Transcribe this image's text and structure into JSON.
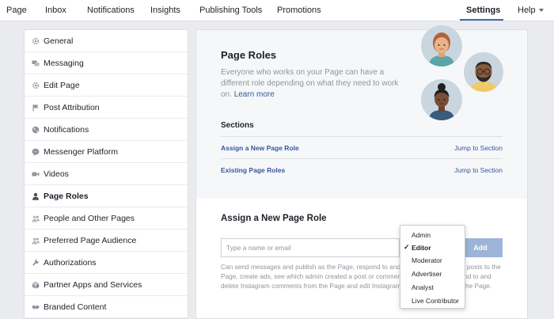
{
  "topnav": {
    "items": [
      "Page",
      "Inbox",
      "Notifications",
      "Insights",
      "Publishing Tools",
      "Promotions"
    ],
    "settings": "Settings",
    "help": "Help"
  },
  "sidebar": {
    "items": [
      {
        "label": "General",
        "icon": "gear-icon"
      },
      {
        "label": "Messaging",
        "icon": "chat-bubbles-icon"
      },
      {
        "label": "Edit Page",
        "icon": "gear-icon"
      },
      {
        "label": "Post Attribution",
        "icon": "flag-icon"
      },
      {
        "label": "Notifications",
        "icon": "globe-icon"
      },
      {
        "label": "Messenger Platform",
        "icon": "messenger-icon"
      },
      {
        "label": "Videos",
        "icon": "video-camera-icon"
      },
      {
        "label": "Page Roles",
        "icon": "person-icon"
      },
      {
        "label": "People and Other Pages",
        "icon": "people-icon"
      },
      {
        "label": "Preferred Page Audience",
        "icon": "people-icon"
      },
      {
        "label": "Authorizations",
        "icon": "wrench-icon"
      },
      {
        "label": "Partner Apps and Services",
        "icon": "cube-icon"
      },
      {
        "label": "Branded Content",
        "icon": "handshake-icon"
      }
    ]
  },
  "page_roles": {
    "title": "Page Roles",
    "description": "Everyone who works on your Page can have a different role depending on what they need to work on.",
    "learn_more": "Learn more",
    "sections_label": "Sections",
    "sections": [
      {
        "name": "Assign a New Page Role",
        "jump": "Jump to Section"
      },
      {
        "name": "Existing Page Roles",
        "jump": "Jump to Section"
      }
    ]
  },
  "assign": {
    "title": "Assign a New Page Role",
    "input_placeholder": "Type a name or email",
    "add_label": "Add",
    "help_text": "Can send messages and publish as the Page, respond to and delete comments and posts to the Page, create ads, see which admin created a post or comment, view insights, respond to and delete Instagram comments from the Page and edit Instagram account details from the Page."
  },
  "dropdown": {
    "options": [
      "Admin",
      "Editor",
      "Moderator",
      "Advertiser",
      "Analyst",
      "Live Contributor"
    ],
    "selected": "Editor",
    "check": "✓"
  },
  "colors": {
    "accent": "#4267b2",
    "link": "#365899",
    "add_button": "#9cb4d8"
  }
}
